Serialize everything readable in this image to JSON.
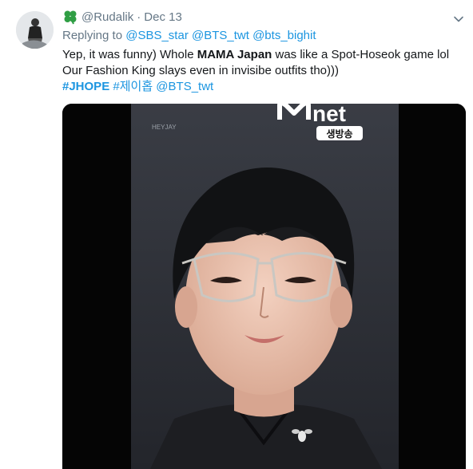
{
  "tweet": {
    "author_handle": "@Rudalik",
    "separator": "·",
    "date": "Dec 13",
    "replying_to_label": "Replying to",
    "replying_to": [
      "@SBS_star",
      "@BTS_twt",
      "@bts_bighit"
    ],
    "text": {
      "part1": "Yep, it was funny) Whole ",
      "bold": "MAMA Japan",
      "part2": " was like a Spot-Hoseok game lol Our Fashion King slays even in invisibe outfits tho)))"
    },
    "hashtags": {
      "tag1": "#JHOPE",
      "tag2": "#제이홉",
      "mention": "@BTS_twt"
    },
    "media": {
      "logo_text": "net",
      "logo_subtext": "생방송",
      "watermark": "HEYJAY"
    }
  },
  "colors": {
    "link": "#1b95e0",
    "secondary_text": "#657786",
    "primary_text": "#14171a",
    "clover": "#2f9e44"
  },
  "icons": {
    "author_badge": "four-leaf-clover-icon",
    "menu": "chevron-down-icon"
  }
}
